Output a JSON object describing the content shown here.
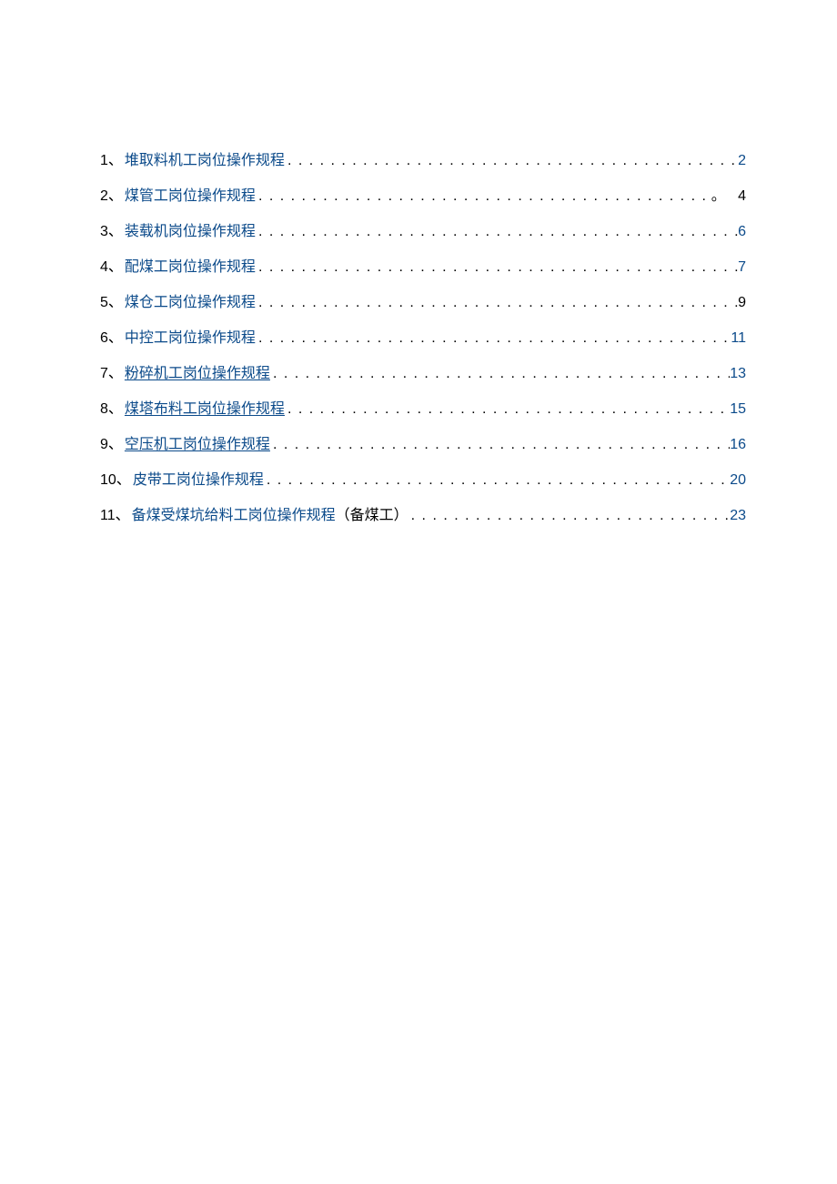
{
  "toc": {
    "entries": [
      {
        "n": "1",
        "title": "堆取料机工岗位操作规程",
        "page": "2",
        "underline": false,
        "page_black": false,
        "suffix": "",
        "extra": ""
      },
      {
        "n": "2",
        "title": "煤管工岗位操作规程",
        "page": "4",
        "underline": false,
        "page_black": true,
        "suffix": "",
        "extra": "。"
      },
      {
        "n": "3",
        "title": "装载机岗位操作规程",
        "page": "6",
        "underline": false,
        "page_black": false,
        "suffix": "",
        "extra": ""
      },
      {
        "n": "4",
        "title": "配煤工岗位操作规程",
        "page": "7",
        "underline": false,
        "page_black": false,
        "suffix": "",
        "extra": ""
      },
      {
        "n": "5",
        "title": "煤仓工岗位操作规程",
        "page": "9",
        "underline": false,
        "page_black": true,
        "suffix": "",
        "extra": ""
      },
      {
        "n": "6",
        "title": "中控工岗位操作规程",
        "page": "11",
        "underline": false,
        "page_black": false,
        "suffix": "",
        "extra": ""
      },
      {
        "n": "7",
        "title": "粉碎机工岗位操作规程",
        "page": "13",
        "underline": true,
        "page_black": false,
        "suffix": "",
        "extra": ""
      },
      {
        "n": "8",
        "title": "煤塔布料工岗位操作规程",
        "page": "15",
        "underline": true,
        "page_black": false,
        "suffix": "",
        "extra": ""
      },
      {
        "n": "9",
        "title": "空压机工岗位操作规程",
        "page": "16",
        "underline": true,
        "page_black": false,
        "suffix": "",
        "extra": ""
      },
      {
        "n": "10",
        "title": "皮带工岗位操作规程",
        "page": "20",
        "underline": false,
        "page_black": false,
        "suffix": "",
        "extra": ""
      },
      {
        "n": "11",
        "title": "备煤受煤坑给料工岗位操作规程",
        "page": "23",
        "underline": false,
        "page_black": false,
        "suffix": "（备煤工）",
        "extra": ""
      }
    ]
  }
}
